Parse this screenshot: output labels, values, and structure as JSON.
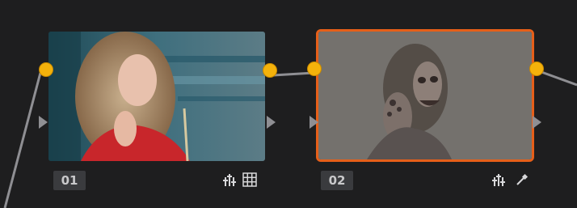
{
  "nodes": [
    {
      "label": "01",
      "icons": [
        "levels-icon",
        "grid-icon"
      ],
      "selected": false
    },
    {
      "label": "02",
      "icons": [
        "levels-icon",
        "eyedropper-icon"
      ],
      "selected": true
    }
  ],
  "colors": {
    "background": "#1e1e1f",
    "port": "#f4b20b",
    "selected_outline": "#e65f19",
    "link": "#8f8f93",
    "label_bg": "#3a3b3e",
    "label_text": "#c9c9cb"
  }
}
